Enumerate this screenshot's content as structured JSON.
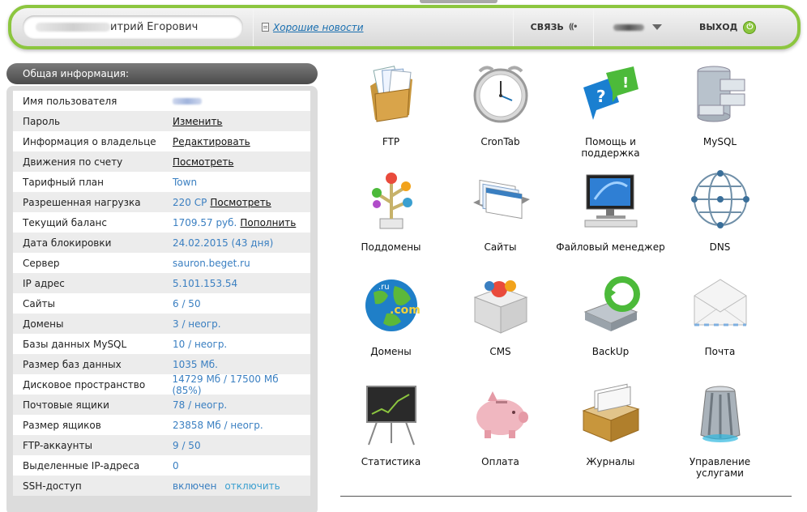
{
  "header": {
    "user_name": "итрий Егорович",
    "news_link": "Хорошие новости",
    "contact_label": "СВЯЗЬ",
    "logout_label": "ВЫХОД"
  },
  "panel": {
    "title": "Общая информация:",
    "rows": [
      {
        "label": "Имя пользователя",
        "value": "",
        "link": ""
      },
      {
        "label": "Пароль",
        "value": "",
        "link": "Изменить"
      },
      {
        "label": "Информация о владельце",
        "value": "",
        "link": "Редактировать"
      },
      {
        "label": "Движения по счету",
        "value": "",
        "link": "Посмотреть"
      },
      {
        "label": "Тарифный план",
        "value": "Town",
        "link": ""
      },
      {
        "label": "Разрешенная нагрузка",
        "value": "220 CP",
        "link": "Посмотреть"
      },
      {
        "label": "Текущий баланс",
        "value": "1709.57 руб.",
        "link": "Пополнить"
      },
      {
        "label": "Дата блокировки",
        "value": "24.02.2015 (43 дня)",
        "link": ""
      },
      {
        "label": "Сервер",
        "value": "sauron.beget.ru",
        "link": ""
      },
      {
        "label": "IP адрес",
        "value": "5.101.153.54",
        "link": ""
      },
      {
        "label": "Сайты",
        "value": "6 / 50",
        "link": ""
      },
      {
        "label": "Домены",
        "value": "3 / неогр.",
        "link": ""
      },
      {
        "label": "Базы данных MySQL",
        "value": "10 / неогр.",
        "link": ""
      },
      {
        "label": "Размер баз данных",
        "value": "1035 Мб.",
        "link": ""
      },
      {
        "label": "Дисковое пространство",
        "value": "14729 Мб / 17500 Мб (85%)",
        "link": ""
      },
      {
        "label": "Почтовые ящики",
        "value": "78 / неогр.",
        "link": ""
      },
      {
        "label": "Размер ящиков",
        "value": "23858 Мб / неогр.",
        "link": ""
      },
      {
        "label": "FTP-аккаунты",
        "value": "9 / 50",
        "link": ""
      },
      {
        "label": "Выделенные IP-адреса",
        "value": "0",
        "link": ""
      },
      {
        "label": "SSH-доступ",
        "value": "включен",
        "link": "",
        "secondary": "отключить"
      }
    ]
  },
  "services": [
    {
      "label": "FTP",
      "icon": "ftp-folder-icon"
    },
    {
      "label": "CronTab",
      "icon": "clock-icon"
    },
    {
      "label": "Помощь и поддержка",
      "icon": "help-bubbles-icon"
    },
    {
      "label": "MySQL",
      "icon": "database-icon"
    },
    {
      "label": "Поддомены",
      "icon": "subdomain-tree-icon"
    },
    {
      "label": "Сайты",
      "icon": "sites-files-icon"
    },
    {
      "label": "Файловый менеджер",
      "icon": "computer-icon"
    },
    {
      "label": "DNS",
      "icon": "network-globe-icon"
    },
    {
      "label": "Домены",
      "icon": "globe-icon"
    },
    {
      "label": "CMS",
      "icon": "box-icon"
    },
    {
      "label": "BackUp",
      "icon": "backup-disk-icon"
    },
    {
      "label": "Почта",
      "icon": "envelope-icon"
    },
    {
      "label": "Статистика",
      "icon": "chart-board-icon"
    },
    {
      "label": "Оплата",
      "icon": "piggy-bank-icon"
    },
    {
      "label": "Журналы",
      "icon": "journal-box-icon"
    },
    {
      "label": "Управление услугами",
      "icon": "server-cylinder-icon"
    }
  ],
  "colors": {
    "accent": "#8cc63f",
    "link": "#3a7fc1"
  }
}
